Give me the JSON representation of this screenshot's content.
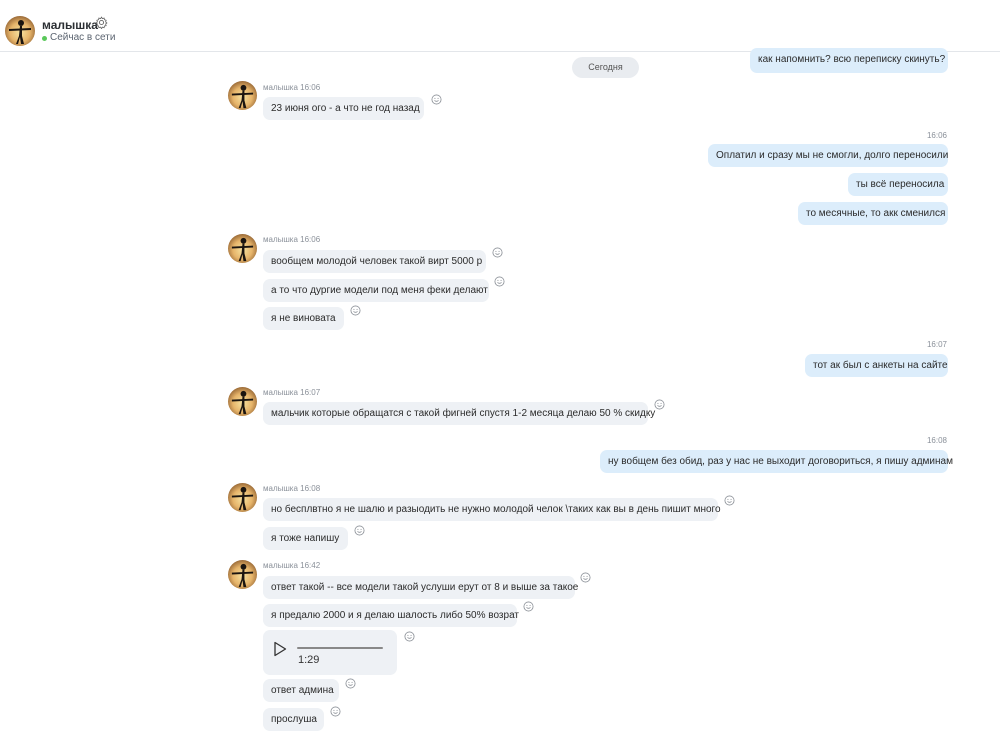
{
  "header": {
    "name": "малышка",
    "status": "Сейчас в сети"
  },
  "date_separator": "Сегодня",
  "messages": {
    "out_top": "как напомнить? всю переписку скинуть?",
    "g1_sender": "малышка 16:06",
    "g1_m1": "23 июня ого - а что не год назад",
    "out1_time": "16:06",
    "out1_m1": "Оплатил и сразу мы не смогли, долго переносили",
    "out1_m2": "ты всё переносила",
    "out1_m3": "то месячные, то акк сменился",
    "g2_sender": "малышка 16:06",
    "g2_m1": "вообщем молодой человек такой вирт 5000 р",
    "g2_m2": "а то что дургие модели под меня феки делают",
    "g2_m3": "я не виновата",
    "out2_time": "16:07",
    "out2_m1": "тот ак был с анкеты на сайте",
    "g3_sender": "малышка 16:07",
    "g3_m1": "мальчик которые обращатся с такой фигней спустя 1-2 месяца делаю 50 % скидку",
    "out3_time": "16:08",
    "out3_m1": "ну вобщем без обид, раз у нас не выходит договориться, я пишу админам",
    "g4_sender": "малышка 16:08",
    "g4_m1": "но бесплвтно я не шалю и разыодить не нужно молодой челок \\таких как вы в день пишит много",
    "g4_m2": "я тоже напишу",
    "g5_sender": "малышка 16:42",
    "g5_m1": "ответ такой -- все модели такой услуши ерут от 8 и выше за такое",
    "g5_m2": "я предалю 2000 и я делаю шалость либо 50% возрат",
    "g5_audio_duration": "1:29",
    "g5_m4": "ответ админа",
    "g5_m5": "прослуша"
  },
  "colors": {
    "incoming_bubble": "#eef1f5",
    "outgoing_bubble": "#dcedfb",
    "online": "#5ac85a"
  },
  "icons": [
    "avatar",
    "gear-icon",
    "smiley-react-icon",
    "play-icon"
  ]
}
